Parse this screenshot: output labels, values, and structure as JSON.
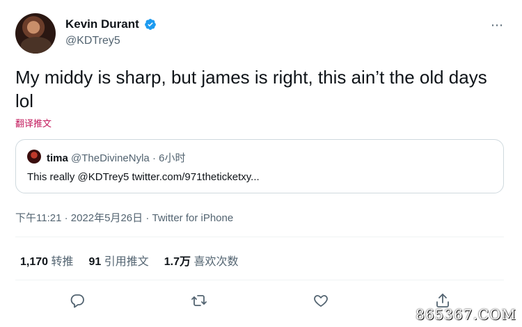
{
  "author": {
    "name": "Kevin Durant",
    "handle": "@KDTrey5",
    "verified": true
  },
  "more_icon": "⋯",
  "tweet": {
    "text": "My middy is sharp, but james is right, this ain’t the old days lol",
    "translate_label": "翻译推文"
  },
  "quote": {
    "name": "tima",
    "handle_time": "@TheDivineNyla · 6小时",
    "text": "This really @KDTrey5 twitter.com/971theticketxy..."
  },
  "meta": {
    "time_date": "下午11:21 · 2022年5月26日 · ",
    "source": "Twitter for iPhone"
  },
  "stats": {
    "retweets_num": "1,170",
    "retweets_label": "转推",
    "quotes_num": "91",
    "quotes_label": "引用推文",
    "likes_num": "1.7万",
    "likes_label": "喜欢次数"
  },
  "icons": {
    "reply": "reply-icon",
    "retweet": "retweet-icon",
    "like": "like-icon",
    "share": "share-icon"
  },
  "colors": {
    "text": "#0f1419",
    "secondary": "#536471",
    "verified": "#1d9bf0",
    "translate": "#c2185b",
    "border": "#cfd9de"
  },
  "watermark": "865367.COM"
}
